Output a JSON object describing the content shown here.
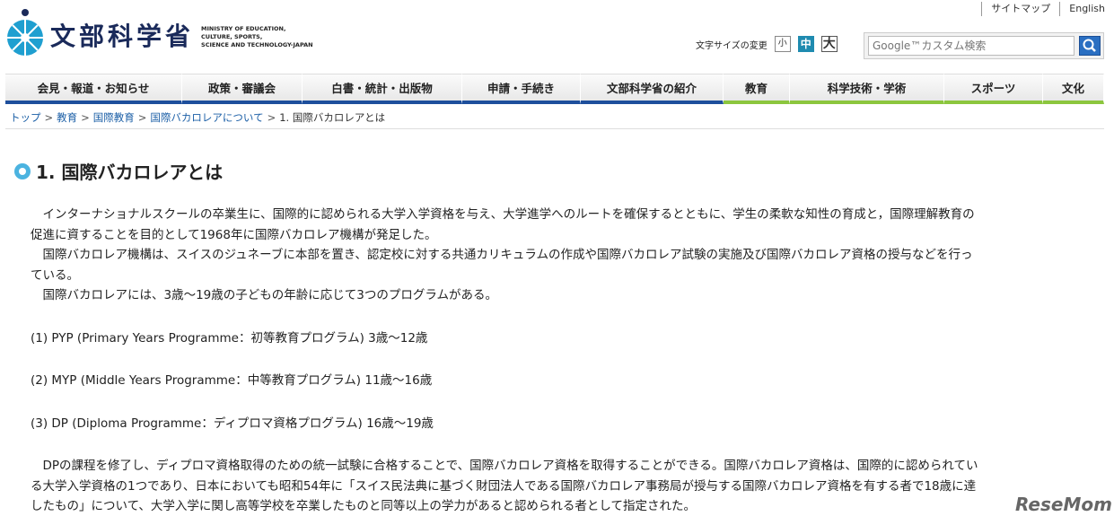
{
  "header": {
    "logo_title": "文部科学省",
    "logo_sub": [
      "MINISTRY OF EDUCATION,",
      "CULTURE, SPORTS,",
      "SCIENCE AND TECHNOLOGY-JAPAN"
    ],
    "top_links": [
      "サイトマップ",
      "English"
    ],
    "font_size_label": "文字サイズの変更",
    "font_size_small": "小",
    "font_size_medium": "中",
    "font_size_large": "大",
    "search_placeholder": "Google™カスタム検索"
  },
  "nav": {
    "items": [
      {
        "label": "会見・報道・お知らせ"
      },
      {
        "label": "政策・審議会"
      },
      {
        "label": "白書・統計・出版物"
      },
      {
        "label": "申請・手続き"
      },
      {
        "label": "文部科学省の紹介"
      },
      {
        "label": "教育"
      },
      {
        "label": "科学技術・学術"
      },
      {
        "label": "スポーツ"
      },
      {
        "label": "文化"
      }
    ]
  },
  "breadcrumb": {
    "items": [
      "トップ",
      "教育",
      "国際教育",
      "国際バカロレアについて"
    ],
    "current": "1. 国際バカロレアとは"
  },
  "main": {
    "title": "1. 国際バカロレアとは",
    "para1_line1": "　インターナショナルスクールの卒業生に、国際的に認められる大学入学資格を与え、大学進学へのルートを確保するとともに、学生の柔軟な知性の育成と，国際理解教育の",
    "para1_line2": "促進に資することを目的として1968年に国際バカロレア機構が発足した。",
    "para2_line1": "　国際バカロレア機構は、スイスのジュネーブに本部を置き、認定校に対する共通カリキュラムの作成や国際バカロレア試験の実施及び国際バカロレア資格の授与などを行っ",
    "para2_line2": "ている。",
    "para3": "　国際バカロレアには、3歳～19歳の子どもの年齢に応じて3つのプログラムがある。",
    "program1": "(1) PYP (Primary Years Programme：初等教育プログラム) 3歳～12歳",
    "program2": "(2) MYP (Middle Years Programme：中等教育プログラム) 11歳～16歳",
    "program3": "(3) DP (Diploma Programme：ディプロマ資格プログラム) 16歳～19歳",
    "para4_line1": "　DPの課程を修了し、ディプロマ資格取得のための統一試験に合格することで、国際バカロレア資格を取得することができる。国際バカロレア資格は、国際的に認められてい",
    "para4_line2": "る大学入学資格の1つであり、日本においても昭和54年に「スイス民法典に基づく財団法人である国際バカロレア事務局が授与する国際バカロレア資格を有する者で18歳に達",
    "para4_line3": "したもの」について、大学入学に関し高等学校を卒業したものと同等以上の学力があると認められる者として指定された。"
  },
  "watermark": "ReseMom",
  "colors": {
    "nav_blue": "#1e4f9c",
    "nav_green": "#8cc63e",
    "link": "#1a5ea6",
    "title_bullet": "#4bb3e0"
  }
}
